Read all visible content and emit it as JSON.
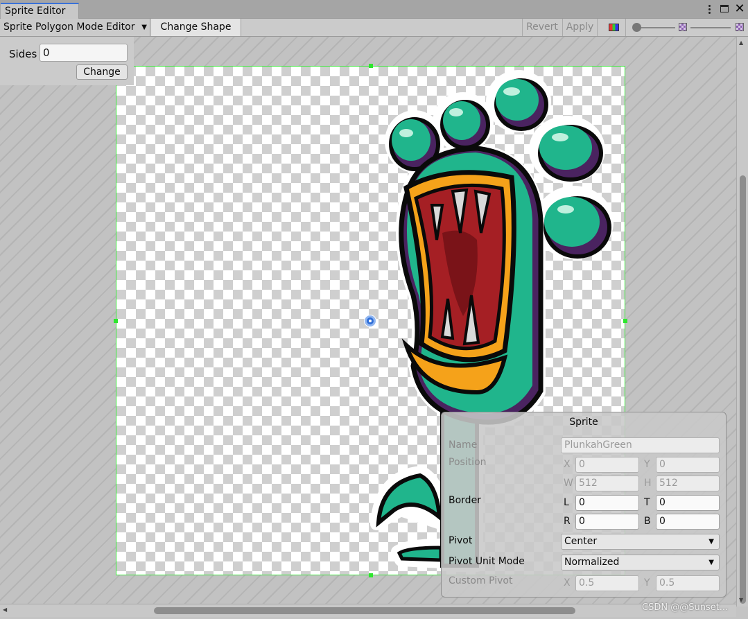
{
  "window": {
    "tab_title": "Sprite Editor"
  },
  "toolbar": {
    "mode_label": "Sprite Polygon Mode Editor",
    "change_shape_label": "Change Shape",
    "revert_label": "Revert",
    "apply_label": "Apply"
  },
  "sides_panel": {
    "label": "Sides",
    "value": "0",
    "change_label": "Change"
  },
  "sprite_panel": {
    "title": "Sprite",
    "name_label": "Name",
    "name_value": "PlunkahGreen",
    "position_label": "Position",
    "x_axis": "X",
    "x_value": "0",
    "y_axis": "Y",
    "y_value": "0",
    "w_axis": "W",
    "w_value": "512",
    "h_axis": "H",
    "h_value": "512",
    "border_label": "Border",
    "l_axis": "L",
    "l_value": "0",
    "t_axis": "T",
    "t_value": "0",
    "r_axis": "R",
    "r_value": "0",
    "b_axis": "B",
    "b_value": "0",
    "pivot_label": "Pivot",
    "pivot_value": "Center",
    "pivot_unit_label": "Pivot Unit Mode",
    "pivot_unit_value": "Normalized",
    "custom_pivot_label": "Custom Pivot",
    "cx_axis": "X",
    "cx_value": "0.5",
    "cy_axis": "Y",
    "cy_value": "0.5"
  },
  "watermark": "CSDN @@Sunset...",
  "colors": {
    "tab_accent": "#3a72d8",
    "sprite_outline": "#39e639",
    "monster_body": "#20b58c",
    "monster_shadow": "#4a2360",
    "mouth_outer": "#f5a21a",
    "mouth_inner": "#a51f24"
  },
  "icons": [
    "kebab-menu-icon",
    "maximize-icon",
    "close-icon",
    "dropdown-arrow-icon",
    "rgb-channel-icon",
    "zoom-slider-icon",
    "mip-level-icon",
    "pivot-handle-icon"
  ]
}
